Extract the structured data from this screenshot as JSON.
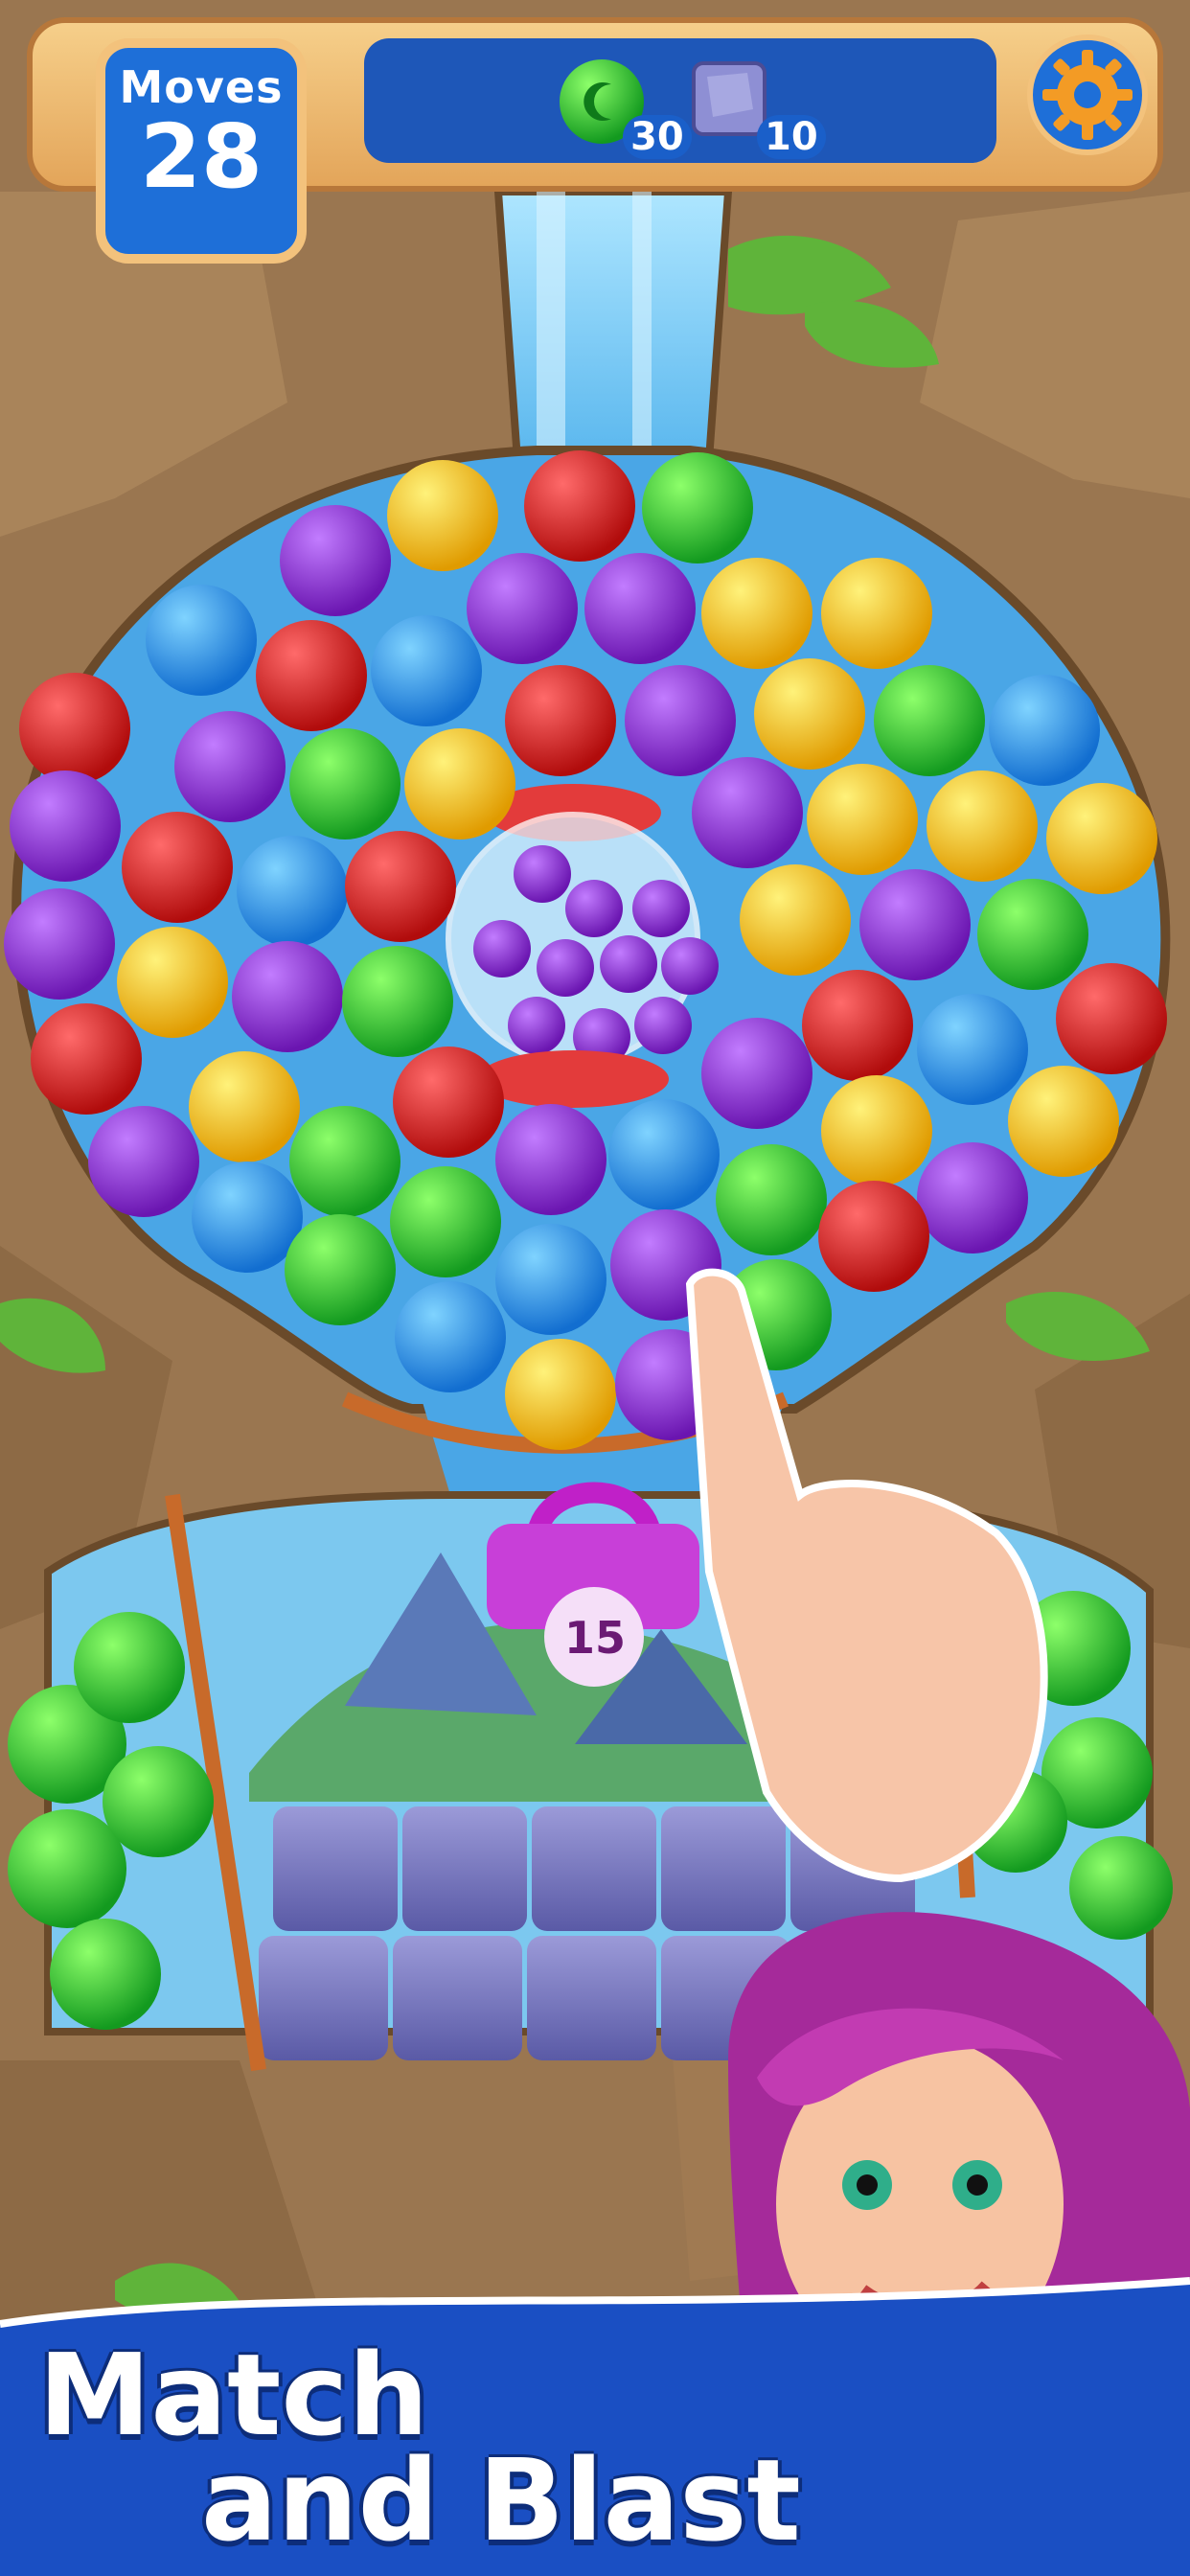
{
  "hud": {
    "moves_label": "Moves",
    "moves_value": "28",
    "goals": [
      {
        "icon": "green-moon-bubble-icon",
        "count": "30"
      },
      {
        "icon": "stone-block-icon",
        "count": "10"
      }
    ],
    "settings_icon": "gear-icon"
  },
  "board": {
    "lock_counter": "15",
    "colors": {
      "purple": "#8a2ad0",
      "yellow": "#f3c81b",
      "red": "#d81f1f",
      "green": "#2fbf3a",
      "blue": "#2a8ee8"
    }
  },
  "banner": {
    "line1": "Match",
    "line2": "and Blast"
  }
}
